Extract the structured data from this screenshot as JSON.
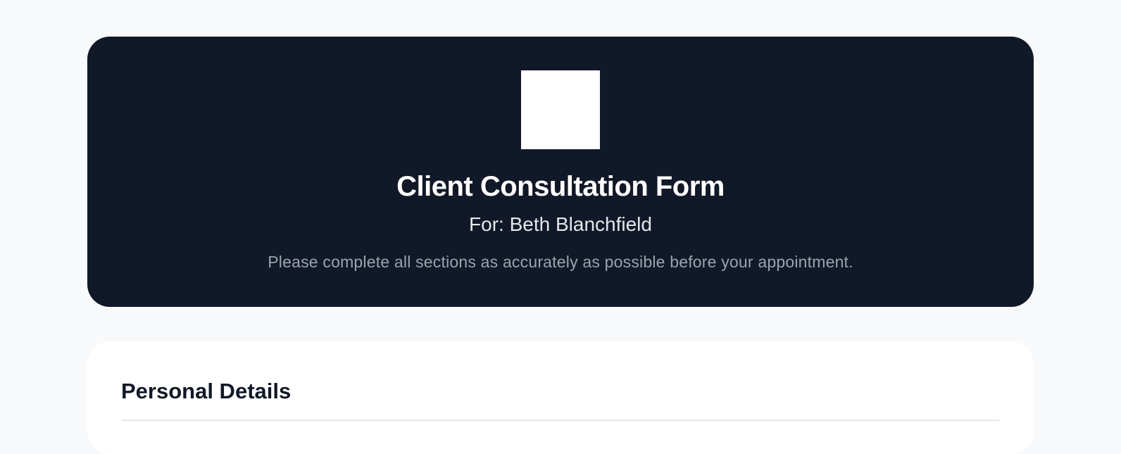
{
  "header": {
    "title": "Client Consultation Form",
    "for_line": "For: Beth Blanchfield",
    "instructions": "Please complete all sections as accurately as possible before your appointment.",
    "logo_icon": "logo-placeholder-icon"
  },
  "sections": [
    {
      "title": "Personal Details"
    }
  ],
  "colors": {
    "page_background": "#f8f9fb",
    "header_background": "#111827",
    "card_background": "#ffffff",
    "text_primary": "#111827",
    "text_muted": "#9ca3af",
    "divider": "#e5e7eb"
  }
}
